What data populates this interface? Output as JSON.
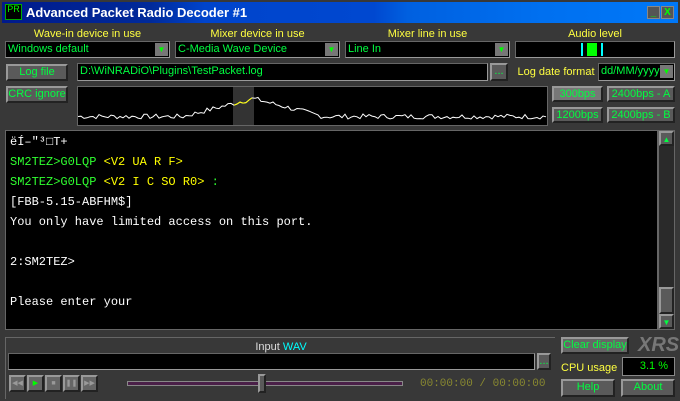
{
  "window": {
    "title": "Advanced Packet Radio Decoder #1",
    "logo": "PR",
    "minimize": "_",
    "close": "X"
  },
  "devices": {
    "wavein": {
      "label": "Wave-in device in use",
      "value": "Windows default"
    },
    "mixer": {
      "label": "Mixer device in use",
      "value": "C-Media Wave Device"
    },
    "line": {
      "label": "Mixer line in use",
      "value": "Line In"
    },
    "audio": {
      "label": "Audio level",
      "level_percent": 50
    }
  },
  "log": {
    "button": "Log file",
    "path": "D:\\WiNRADiO\\Plugins\\TestPacket.log",
    "browse": "...",
    "date_label": "Log date format",
    "date_value": "dd/MM/yyyy"
  },
  "crc_button": "CRC ignore",
  "baud": {
    "b300": "300bps",
    "b1200": "1200bps",
    "b2400a": "2400bps - A",
    "b2400b": "2400bps - B"
  },
  "terminal": {
    "lines": [
      {
        "parts": [
          {
            "t": "ëÍ–″³□T+",
            "c": ""
          }
        ]
      },
      {
        "parts": [
          {
            "t": "SM2TEZ>G0LQP ",
            "c": "g"
          },
          {
            "t": "<V2 UA R F>",
            "c": "y"
          }
        ]
      },
      {
        "parts": [
          {
            "t": "SM2TEZ>G0LQP ",
            "c": "g"
          },
          {
            "t": "<V2 I C SO R0>",
            "c": "y"
          },
          {
            "t": " :",
            "c": "g"
          }
        ]
      },
      {
        "parts": [
          {
            "t": "[FBB-5.15-ABFHM$]",
            "c": ""
          }
        ]
      },
      {
        "parts": [
          {
            "t": "You only have limited access on this port.",
            "c": ""
          }
        ]
      },
      {
        "parts": [
          {
            "t": "",
            "c": ""
          }
        ]
      },
      {
        "parts": [
          {
            "t": "2:SM2TEZ>",
            "c": ""
          }
        ]
      },
      {
        "parts": [
          {
            "t": "",
            "c": ""
          }
        ]
      },
      {
        "parts": [
          {
            "t": "Please enter your",
            "c": ""
          }
        ]
      }
    ]
  },
  "input": {
    "label_a": "Input",
    "label_b": "WAV",
    "browse": "...",
    "time": "00:00:00 / 00:00:00"
  },
  "side": {
    "clear": "Clear display",
    "brand": "XRS",
    "cpu_label": "CPU usage",
    "cpu_value": "3.1 %",
    "help": "Help",
    "about": "About"
  },
  "transport": [
    "rewind-icon",
    "play-icon",
    "stop-icon",
    "pause-icon",
    "fast-forward-icon"
  ]
}
